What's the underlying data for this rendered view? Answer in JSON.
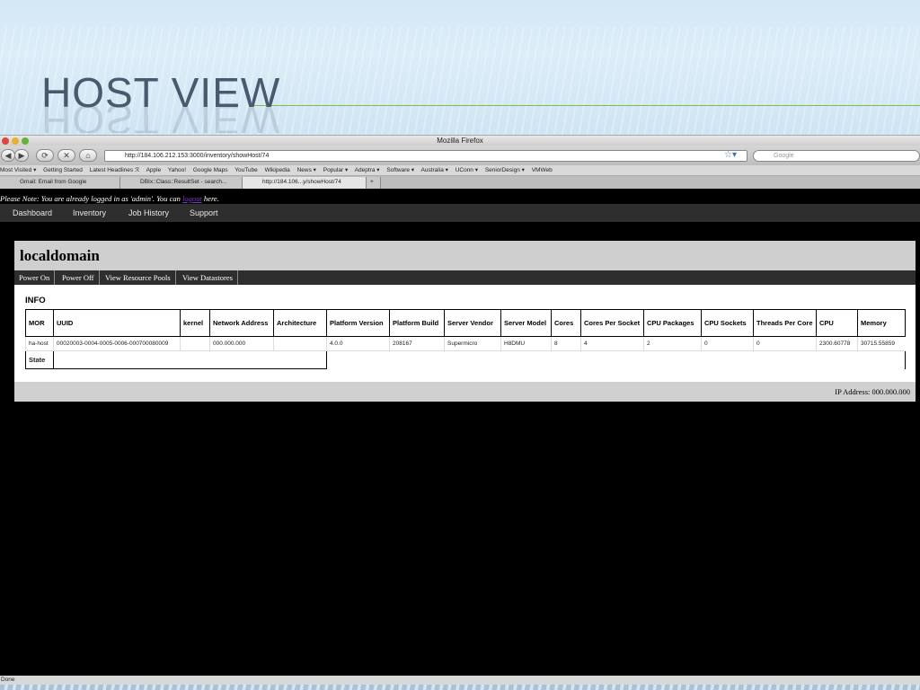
{
  "slide": {
    "title": "HOST VIEW"
  },
  "browser": {
    "window_title": "Mozilla Firefox",
    "url": "http://184.106.212.153:3000/inventory/showHost/74",
    "search_placeholder": "Google",
    "bookmarks": [
      "Most Visited ▾",
      "Getting Started",
      "Latest Headlines ℛ",
      "Apple",
      "Yahoo!",
      "Google Maps",
      "YouTube",
      "Wikipedia",
      "News ▾",
      "Popular ▾",
      "Adeptra ▾",
      "Software ▾",
      "Australia ▾",
      "UConn ▾",
      "SeniorDesign ▾",
      "VMWeb"
    ],
    "tabs": [
      "Gmail: Email from Google",
      "DBIx::Class::ResultSet - search...",
      "http://184.106...y/showHost/74"
    ],
    "status": "Done"
  },
  "notice": {
    "prefix": "Please Note: You are already logged in as 'admin'. You can ",
    "link": "logout",
    "suffix": " here."
  },
  "nav": [
    "Dashboard",
    "Inventory",
    "Job History",
    "Support"
  ],
  "host": {
    "name": "localdomain",
    "actions": [
      "Power On",
      "Power Off",
      "View Resource Pools",
      "View Datastores"
    ],
    "info_label": "INFO",
    "columns": [
      "MOR",
      "UUID",
      "kernel",
      "Network Address",
      "Architecture",
      "Platform Version",
      "Platform Build",
      "Server Vendor",
      "Server Model",
      "Cores",
      "Cores Per Socket",
      "CPU Packages",
      "CPU Sockets",
      "Threads Per Core",
      "CPU",
      "Memory"
    ],
    "row": [
      "ha-host",
      "00020003-0004-0005-0006-000700080009",
      "",
      "000.000.000",
      "",
      "4.0.0",
      "208167",
      "Supermicro",
      "H8DMU",
      "8",
      "4",
      "2",
      "0",
      "0",
      "2300.60778",
      "30715.55859"
    ],
    "state_label": "State",
    "state_value": "",
    "ip": "IP Address: 000.000.000"
  }
}
